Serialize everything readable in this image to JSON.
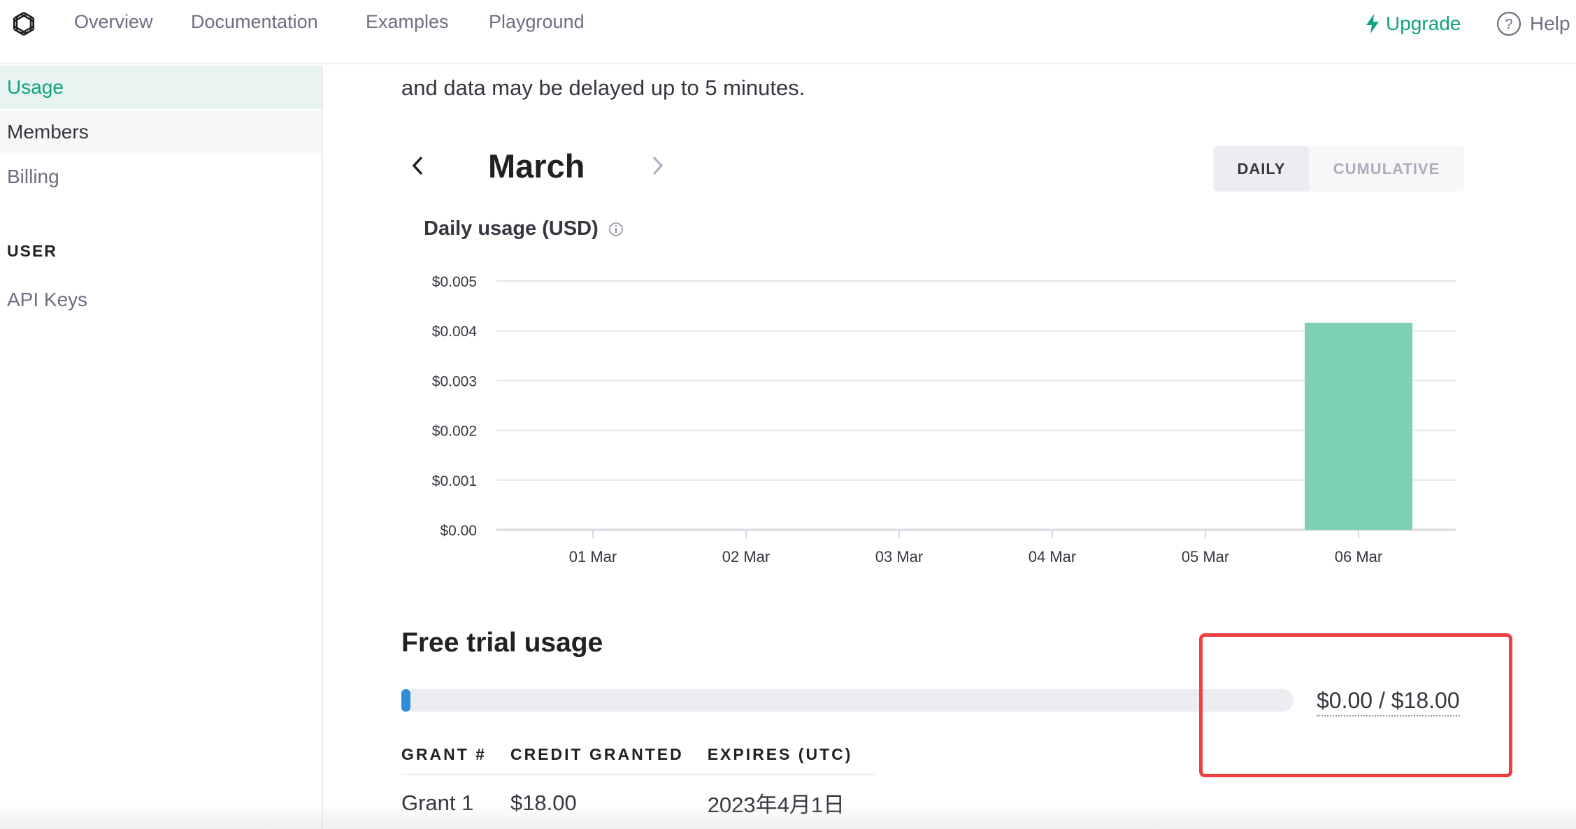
{
  "nav": {
    "links": [
      "Overview",
      "Documentation",
      "Examples",
      "Playground"
    ],
    "upgrade_label": "Upgrade",
    "help_label": "Help"
  },
  "sidebar": {
    "items": [
      {
        "label": "Usage",
        "state": "active"
      },
      {
        "label": "Members",
        "state": "hover"
      },
      {
        "label": "Billing",
        "state": "normal"
      }
    ],
    "user_heading": "USER",
    "user_items": [
      "API Keys"
    ]
  },
  "main": {
    "intro_text": "and data may be delayed up to 5 minutes.",
    "month": "March",
    "toggle": {
      "daily": "DAILY",
      "cumulative": "CUMULATIVE",
      "selected": "daily"
    },
    "chart_title": "Daily usage (USD)"
  },
  "chart_data": {
    "type": "bar",
    "title": "Daily usage (USD)",
    "categories": [
      "01 Mar",
      "02 Mar",
      "03 Mar",
      "04 Mar",
      "05 Mar",
      "06 Mar"
    ],
    "values": [
      0,
      0,
      0,
      0,
      0,
      0.00416
    ],
    "yticks": [
      "$0.00",
      "$0.001",
      "$0.002",
      "$0.003",
      "$0.004",
      "$0.005"
    ],
    "ylim": [
      0,
      0.005
    ],
    "grid": true,
    "bar_color": "#7dcfb6"
  },
  "trial": {
    "title": "Free trial usage",
    "amount_text": "$0.00 / $18.00",
    "used": 0.0,
    "total": 18.0,
    "bar_color": "#2d8fdb"
  },
  "grants": {
    "headers": [
      "GRANT #",
      "CREDIT GRANTED",
      "EXPIRES (UTC)"
    ],
    "rows": [
      [
        "Grant 1",
        "$18.00",
        "2023年4月1日"
      ]
    ]
  },
  "colors": {
    "accent": "#10a37f",
    "highlight": "#ee4040"
  }
}
